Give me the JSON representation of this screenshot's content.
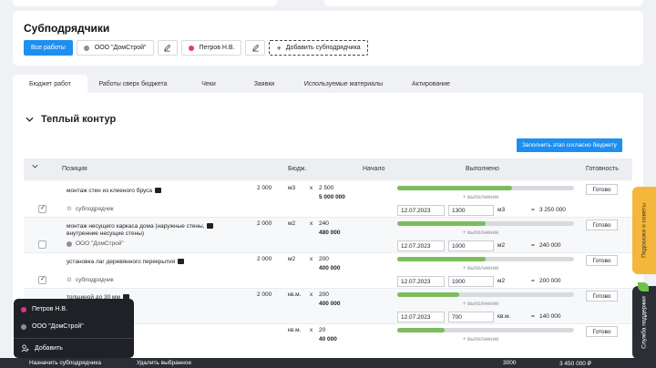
{
  "subcontractors": {
    "title": "Субподрядчики",
    "all_works": "Все работы",
    "items": [
      {
        "name": "ООО \"ДомСтрой\"",
        "color": "#8e8e93"
      },
      {
        "name": "Петров Н.В.",
        "color": "#e2338f"
      }
    ],
    "add_label": "Добавить субподрядчика"
  },
  "tabs": [
    "Бюджет работ",
    "Работы сверх бюджета",
    "Чеки",
    "Заявки",
    "Используемые материалы",
    "Актирование"
  ],
  "section": {
    "title": "Теплый контур",
    "fill_button": "Заполнить этап согласно бюджету"
  },
  "table": {
    "headers": {
      "position": "Позиция",
      "budget": "Бюдж.",
      "start": "Начало",
      "done": "Выполнено",
      "ready": "Готовность"
    },
    "add_progress": "+ выполнение",
    "ready_label": "Готово",
    "rows": [
      {
        "name": "монтаж стен из клееного бруса",
        "name2": "",
        "assignee": "субподрядчик",
        "assignee_icon": "gear-icon",
        "checked": true,
        "date": "2 000",
        "unit": "м3",
        "mul": "x",
        "qty": "2 500",
        "total": "5 000 000",
        "progress": 0.65,
        "done_date": "12.07.2023",
        "done_qty": "1300",
        "done_unit": "м3",
        "eq": "=",
        "done_sum": "3 250 000"
      },
      {
        "name": "монтаж несущего каркаса дома (наружные стены,",
        "name2": "внутренние несущие стены)",
        "assignee": "ООО \"ДомСтрой\"",
        "assignee_icon": "dot",
        "checked": false,
        "date": "2 000",
        "unit": "м2",
        "mul": "x",
        "qty": "240",
        "total": "480 000",
        "progress": 0.5,
        "done_date": "12.07.2023",
        "done_qty": "1000",
        "done_unit": "м2",
        "eq": "=",
        "done_sum": "240 000"
      },
      {
        "name": "установка лаг деревянного перекрытия",
        "name2": "",
        "assignee": "субподрядчик",
        "assignee_icon": "gear-icon",
        "checked": true,
        "date": "2 000",
        "unit": "м2",
        "mul": "x",
        "qty": "200",
        "total": "400 000",
        "progress": 0.5,
        "done_date": "12.07.2023",
        "done_qty": "1000",
        "done_unit": "м2",
        "eq": "=",
        "done_sum": "200 000"
      },
      {
        "name": "толщиной до 30 мм",
        "name2": "",
        "assignee": "",
        "assignee_icon": "",
        "checked": false,
        "date": "2 000",
        "unit": "кв.м.",
        "mul": "x",
        "qty": "200",
        "total": "400 000",
        "progress": 0.35,
        "done_date": "12.07.2023",
        "done_qty": "700",
        "done_unit": "кв.м.",
        "eq": "=",
        "done_sum": "140 000"
      },
      {
        "name": "",
        "name2": "",
        "assignee": "",
        "assignee_icon": "",
        "checked": false,
        "date": "",
        "unit": "кв.м.",
        "mul": "x",
        "qty": "20",
        "total": "40 000",
        "progress": 0.27,
        "done_date": "",
        "done_qty": "",
        "done_unit": "",
        "eq": "",
        "done_sum": ""
      }
    ]
  },
  "side_tabs": {
    "tips": "Подсказки и советы",
    "support": "Служба поддержки"
  },
  "popup": {
    "items": [
      "Петров Н.В.",
      "ООО \"ДомСтрой\""
    ],
    "add": "Добавить"
  },
  "bottom_bar": {
    "left": "Назначить субподрядчика",
    "mid": "Удалить выбранное",
    "count": "3000",
    "sum": "3 450 000 ₽"
  }
}
